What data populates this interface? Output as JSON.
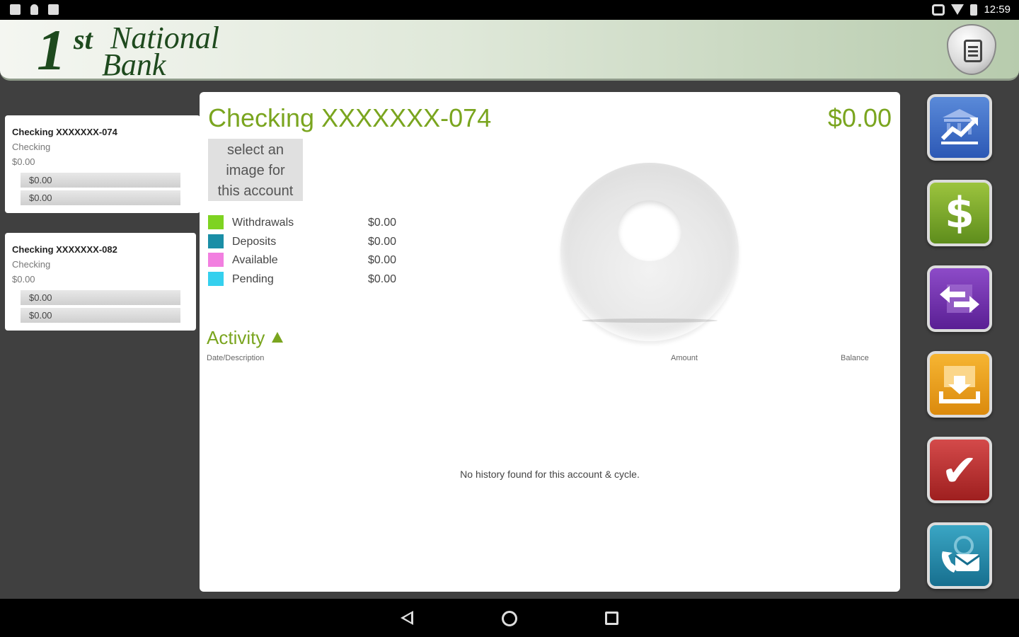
{
  "status_bar": {
    "time": "12:59",
    "icons": [
      "notification-icon",
      "location-icon",
      "photo-icon",
      "vibrate-icon",
      "wifi-icon",
      "battery-icon"
    ]
  },
  "header": {
    "logo": {
      "one": "1",
      "st": "st",
      "national": "National",
      "bank": "Bank"
    },
    "logo_color": "#1e4a1e",
    "lock_button_icon": "lock-icon"
  },
  "accounts": [
    {
      "name": "Checking XXXXXXX-074",
      "type": "Checking",
      "balance": "$0.00",
      "bar1": "$0.00",
      "bar2": "$0.00"
    },
    {
      "name": "Checking XXXXXXX-082",
      "type": "Checking",
      "balance": "$0.00",
      "bar1": "$0.00",
      "bar2": "$0.00"
    }
  ],
  "main": {
    "account_title": "Checking XXXXXXX-074",
    "account_total": "$0.00",
    "accent_color": "#7aa51f",
    "select_image": {
      "line1": "select an",
      "line2": "image for",
      "line3": "this account"
    },
    "legend": [
      {
        "label": "Withdrawals",
        "value": "$0.00",
        "color": "#7ed321"
      },
      {
        "label": "Deposits",
        "value": "$0.00",
        "color": "#1a8ea6"
      },
      {
        "label": "Available",
        "value": "$0.00",
        "color": "#f27fe0"
      },
      {
        "label": "Pending",
        "value": "$0.00",
        "color": "#35d0ee"
      }
    ],
    "activity": {
      "title": "Activity",
      "col_date": "Date/Description",
      "col_amount": "Amount",
      "col_balance": "Balance",
      "empty": "No history found for this account & cycle."
    }
  },
  "actions": [
    {
      "icon": "accounts-chart-icon",
      "color": "#2c58b5"
    },
    {
      "icon": "dollar-icon",
      "color": "#5e8d1c",
      "glyph": "$"
    },
    {
      "icon": "transfer-icon",
      "color": "#5a1f94"
    },
    {
      "icon": "deposit-download-icon",
      "color": "#db8a0d"
    },
    {
      "icon": "bill-pay-check-icon",
      "color": "#9e1f1f",
      "glyph": "✔"
    },
    {
      "icon": "contact-icon",
      "color": "#176f8f"
    }
  ]
}
